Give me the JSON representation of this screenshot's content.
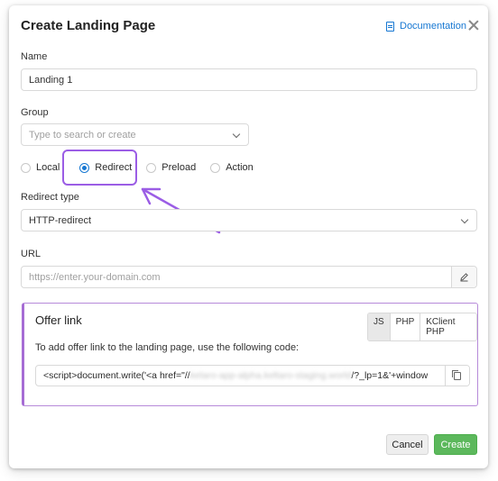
{
  "dialog": {
    "title": "Create Landing Page",
    "documentation_label": "Documentation"
  },
  "name": {
    "label": "Name",
    "value": "Landing 1"
  },
  "group": {
    "label": "Group",
    "placeholder": "Type to search or create"
  },
  "type_options": [
    {
      "label": "Local",
      "checked": false
    },
    {
      "label": "Redirect",
      "checked": true
    },
    {
      "label": "Preload",
      "checked": false
    },
    {
      "label": "Action",
      "checked": false
    }
  ],
  "redirect_type": {
    "label": "Redirect type",
    "value": "HTTP-redirect"
  },
  "url": {
    "label": "URL",
    "placeholder": "https://enter.your-domain.com"
  },
  "offer_link": {
    "title": "Offer link",
    "tabs": [
      "JS",
      "PHP",
      "KClient PHP"
    ],
    "active_tab": "JS",
    "description": "To add offer link to the landing page, use the following code:",
    "code_prefix": "<script>document.write('<a href=\"//",
    "code_blurred": "kelaro-app-alpha.keltaro-staging.world",
    "code_suffix": "/?_lp=1&'+window"
  },
  "footer": {
    "cancel_label": "Cancel",
    "create_label": "Create"
  },
  "colors": {
    "accent": "#1677d2",
    "highlight": "#9b5de5",
    "create": "#5cb85c"
  }
}
